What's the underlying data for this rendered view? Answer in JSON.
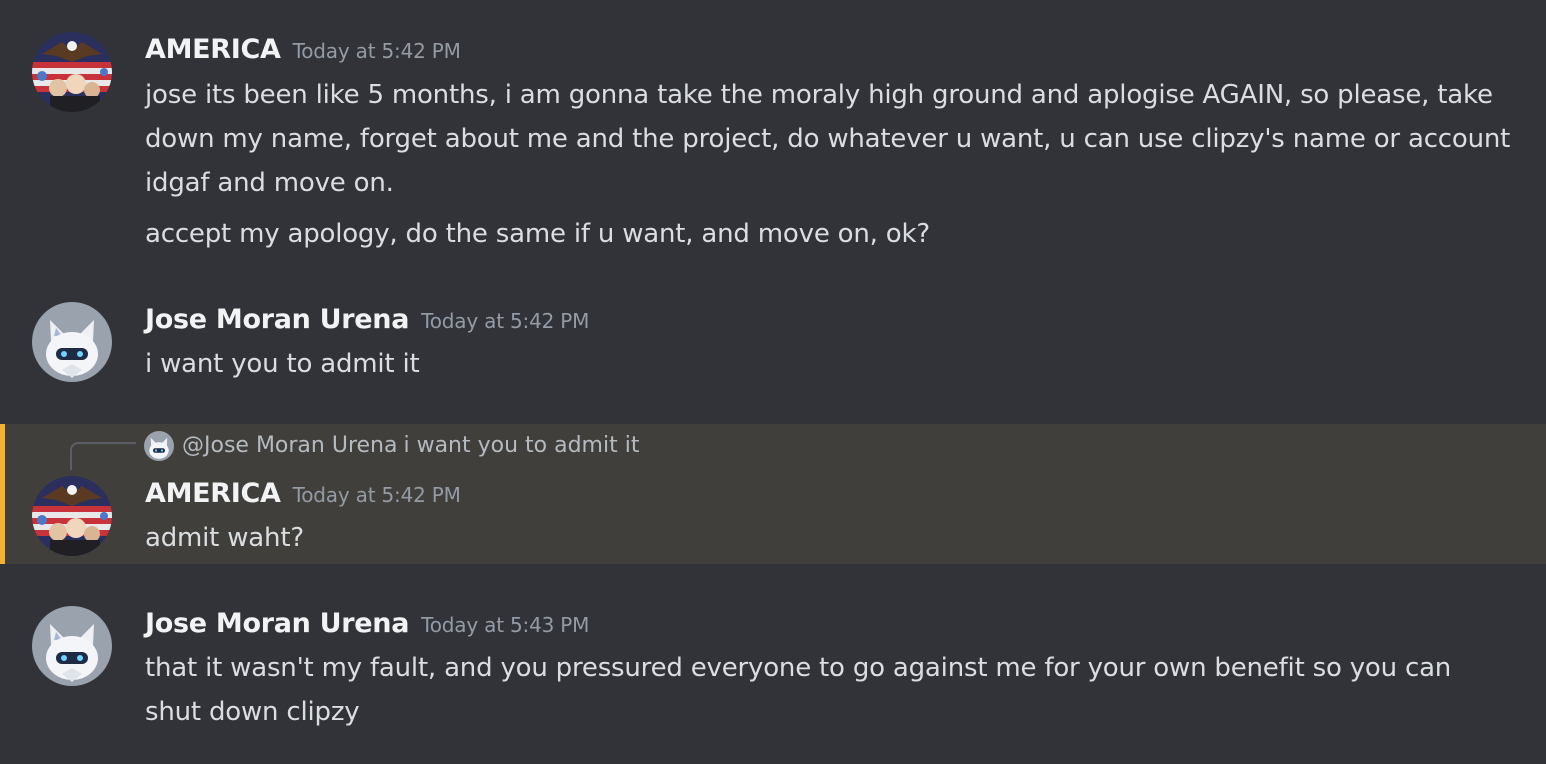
{
  "messages": [
    {
      "author": "AMERICA",
      "time": "Today at 5:42 PM",
      "lines": [
        "jose its been like 5 months, i am gonna take the moraly high ground and aplogise AGAIN, so please, take down my name, forget about me and the project, do whatever u want, u can use clipzy's name or account idgaf and move on.",
        "accept my apology, do the same if u want, and move on, ok?"
      ]
    },
    {
      "author": "Jose Moran Urena",
      "time": "Today at 5:42 PM",
      "lines": [
        "i want you to admit it"
      ]
    },
    {
      "author": "AMERICA",
      "time": "Today at 5:42 PM",
      "reply": {
        "author": "@Jose Moran Urena",
        "text": "i want you to admit it"
      },
      "lines": [
        "admit waht?"
      ]
    },
    {
      "author": "Jose Moran Urena",
      "time": "Today at 5:43 PM",
      "lines": [
        "that it wasn't my fault, and you pressured everyone to go against me for your own benefit so you can shut down clipzy"
      ]
    }
  ],
  "colors": {
    "background": "#313338",
    "mention_highlight": "#413f3b",
    "mention_bar": "#f0b232",
    "author": "#f2f3f5",
    "timestamp": "#949ba4",
    "text": "#dbdee1"
  },
  "icons": {
    "america_avatar": "eagle-flag-presidents-avatar",
    "jose_avatar": "white-fox-character-avatar"
  }
}
